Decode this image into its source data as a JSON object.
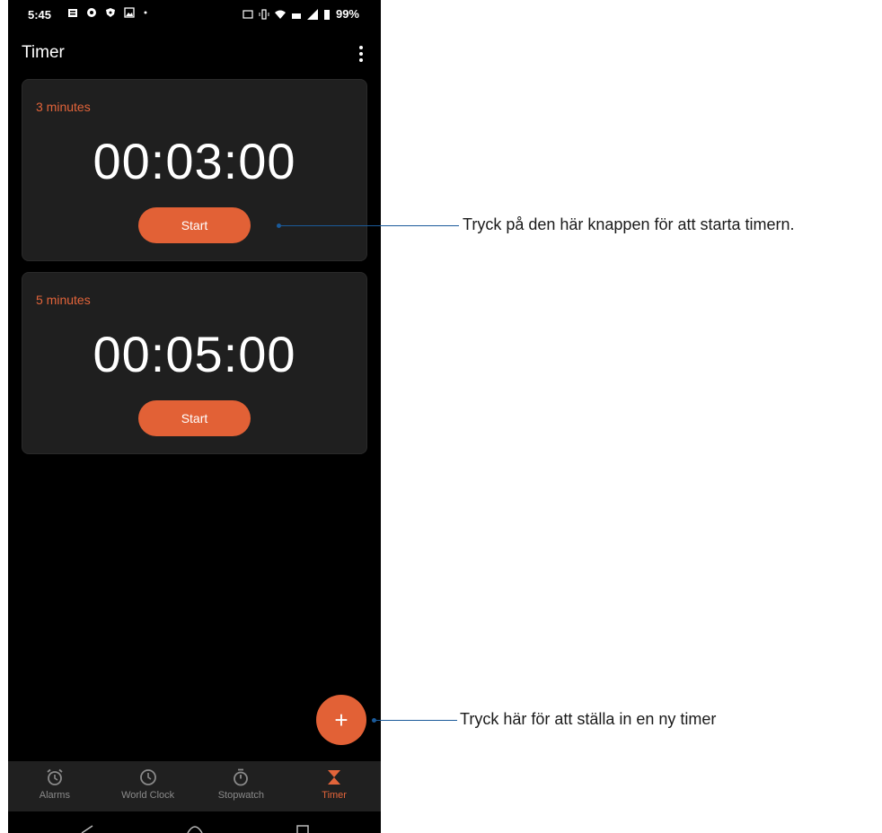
{
  "status_bar": {
    "time": "5:45",
    "battery": "99%"
  },
  "app_bar": {
    "title": "Timer"
  },
  "timers": [
    {
      "label": "3 minutes",
      "time": "00:03:00",
      "button": "Start"
    },
    {
      "label": "5 minutes",
      "time": "00:05:00",
      "button": "Start"
    }
  ],
  "fab": {
    "symbol": "+"
  },
  "bottom_nav": {
    "tabs": [
      {
        "label": "Alarms",
        "icon": "alarm-icon"
      },
      {
        "label": "World Clock",
        "icon": "clock-icon"
      },
      {
        "label": "Stopwatch",
        "icon": "stopwatch-icon"
      },
      {
        "label": "Timer",
        "icon": "hourglass-icon",
        "active": true
      }
    ]
  },
  "annotations": [
    {
      "text": "Tryck på den här knappen för att starta timern."
    },
    {
      "text": "Tryck här för att ställa in en ny timer"
    }
  ],
  "colors": {
    "accent": "#e26136",
    "card": "#1f1f1f",
    "background": "#000000",
    "callout": "#1a5a9a"
  }
}
